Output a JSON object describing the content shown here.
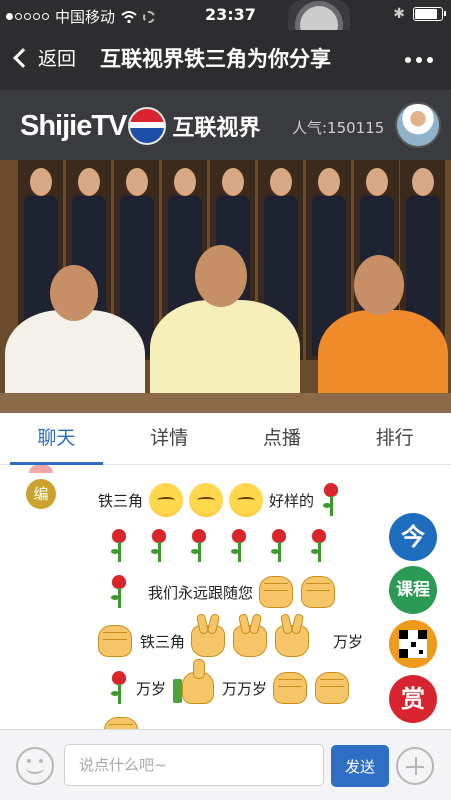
{
  "status_bar": {
    "carrier": "中国移动",
    "time": "23:37",
    "signal_icon": "signal-dots-icon",
    "wifi_icon": "wifi-icon",
    "loading_icon": "activity-spinner-icon",
    "bluetooth_icon": "bluetooth-icon",
    "battery_icon": "battery-icon",
    "battery_level": 0.85
  },
  "nav": {
    "back_label": "返回",
    "title": "互联视界铁三角为你分享",
    "more_icon": "ellipsis-icon"
  },
  "channel": {
    "logo_text": "ShijieTV",
    "logo_cn": "互联视界",
    "popularity": "人气:150115"
  },
  "tabs": [
    {
      "label": "聊天",
      "active": true
    },
    {
      "label": "详情",
      "active": false
    },
    {
      "label": "点播",
      "active": false
    },
    {
      "label": "排行",
      "active": false
    }
  ],
  "chat": {
    "editor_badge": "编",
    "line1_text": "铁三角",
    "line1_tail": "好样的",
    "line3_text": "我们永远跟随您",
    "line4_text": "铁三角",
    "line4_tail": "万岁",
    "line5_text": "万岁",
    "line5_tail": "万万岁"
  },
  "side_buttons": {
    "today": "今",
    "course": "课程",
    "qr_icon": "qr-code-icon",
    "reward": "赏"
  },
  "input_bar": {
    "placeholder": "说点什么吧~",
    "send_label": "发送",
    "emoji_icon": "smiley-icon",
    "plus_icon": "plus-icon"
  },
  "colors": {
    "accent": "#2a6dc2",
    "header_bg": "#2d2d30",
    "today": "#1f6dbe",
    "course": "#2b9a55",
    "qr": "#f09a1b",
    "reward": "#d8242f"
  }
}
